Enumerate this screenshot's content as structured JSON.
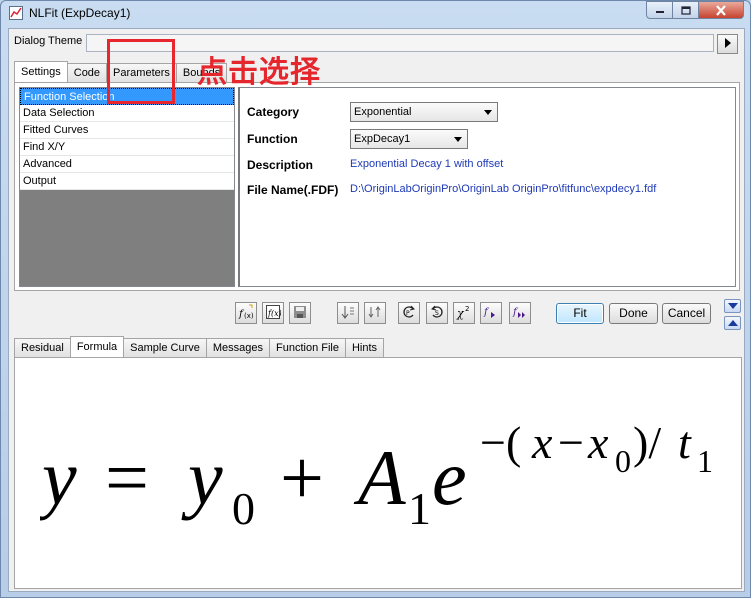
{
  "window": {
    "title": "NLFit (ExpDecay1)",
    "icons": {
      "app": "nlfit-app-icon",
      "minimize": "minimize-icon",
      "maximize": "maximize-icon",
      "close": "close-icon"
    }
  },
  "theme": {
    "label": "Dialog Theme",
    "value": "",
    "arrow_icon": "arrow-right-icon"
  },
  "top_tabs": [
    "Settings",
    "Code",
    "Parameters",
    "Bounds"
  ],
  "nav": {
    "items": [
      "Function Selection",
      "Data Selection",
      "Fitted Curves",
      "Find X/Y",
      "Advanced",
      "Output"
    ],
    "selected": "Function Selection"
  },
  "details": {
    "category_label": "Category",
    "category_value": "Exponential",
    "function_label": "Function",
    "function_value": "ExpDecay1",
    "description_label": "Description",
    "description_value": "Exponential Decay 1 with offset",
    "file_label": "File Name(.FDF)",
    "file_value": "D:\\OriginLabOriginPro\\OriginLab OriginPro\\fitfunc\\expdecy1.fdf"
  },
  "toolbar": {
    "icons": [
      "new-function-icon",
      "edit-function-icon",
      "save-icon",
      "sort-icon",
      "fit-until-converged-icon",
      "reset-icon",
      "undo-icon",
      "chi-square-icon",
      "one-iteration-icon",
      "fit-until-done-icon"
    ],
    "fit_label": "Fit",
    "done_label": "Done",
    "cancel_label": "Cancel",
    "collapse_icon": "chevron-down-icon",
    "expand_icon": "chevron-up-icon"
  },
  "bottom_tabs": [
    "Residual",
    "Formula",
    "Sample Curve",
    "Messages",
    "Function File",
    "Hints"
  ],
  "active_bottom_tab": "Formula",
  "formula": "y = y0 + A1e^-(x-x0)/t1",
  "annotation": {
    "text": "点击选择",
    "color": "#e5262d"
  },
  "colors": {
    "selection": "#3399ff",
    "link_text": "#1f3ab7",
    "highlight": "#e8262e"
  }
}
